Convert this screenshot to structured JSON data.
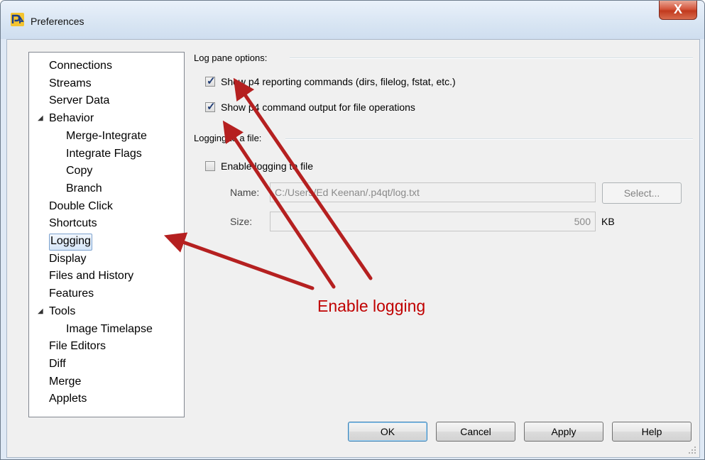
{
  "window": {
    "title": "Preferences",
    "close_label": "X"
  },
  "tree": {
    "items": [
      {
        "label": "Connections",
        "level": 0
      },
      {
        "label": "Streams",
        "level": 0
      },
      {
        "label": "Server Data",
        "level": 0
      },
      {
        "label": "Behavior",
        "level": 0,
        "expanded": true
      },
      {
        "label": "Merge-Integrate",
        "level": 1
      },
      {
        "label": "Integrate Flags",
        "level": 1
      },
      {
        "label": "Copy",
        "level": 1
      },
      {
        "label": "Branch",
        "level": 1
      },
      {
        "label": "Double Click",
        "level": 0
      },
      {
        "label": "Shortcuts",
        "level": 0
      },
      {
        "label": "Logging",
        "level": 0,
        "selected": true
      },
      {
        "label": "Display",
        "level": 0
      },
      {
        "label": "Files and History",
        "level": 0
      },
      {
        "label": "Features",
        "level": 0
      },
      {
        "label": "Tools",
        "level": 0,
        "expanded": true
      },
      {
        "label": "Image Timelapse",
        "level": 1
      },
      {
        "label": "File Editors",
        "level": 0
      },
      {
        "label": "Diff",
        "level": 0
      },
      {
        "label": "Merge",
        "level": 0
      },
      {
        "label": "Applets",
        "level": 0
      }
    ],
    "expanded_glyph": "◢"
  },
  "log_pane": {
    "title": "Log pane options:",
    "show_reporting": {
      "label": "Show p4 reporting commands (dirs, filelog, fstat, etc.)",
      "checked": true
    },
    "show_output": {
      "label": "Show p4 command output for file operations",
      "checked": true
    }
  },
  "logging_file": {
    "title": "Logging to a file:",
    "enable": {
      "label": "Enable logging to file",
      "checked": false
    },
    "name_label": "Name:",
    "name_value": "C:/Users/Ed Keenan/.p4qt/log.txt",
    "select_label": "Select...",
    "size_label": "Size:",
    "size_value": "500",
    "size_unit": "KB"
  },
  "buttons": {
    "ok": "OK",
    "cancel": "Cancel",
    "apply": "Apply",
    "help": "Help"
  },
  "annotation": {
    "text": "Enable logging",
    "color": "#c00000"
  },
  "colors": {
    "selection_border": "#7da2ce",
    "check": "#1f3b73"
  }
}
